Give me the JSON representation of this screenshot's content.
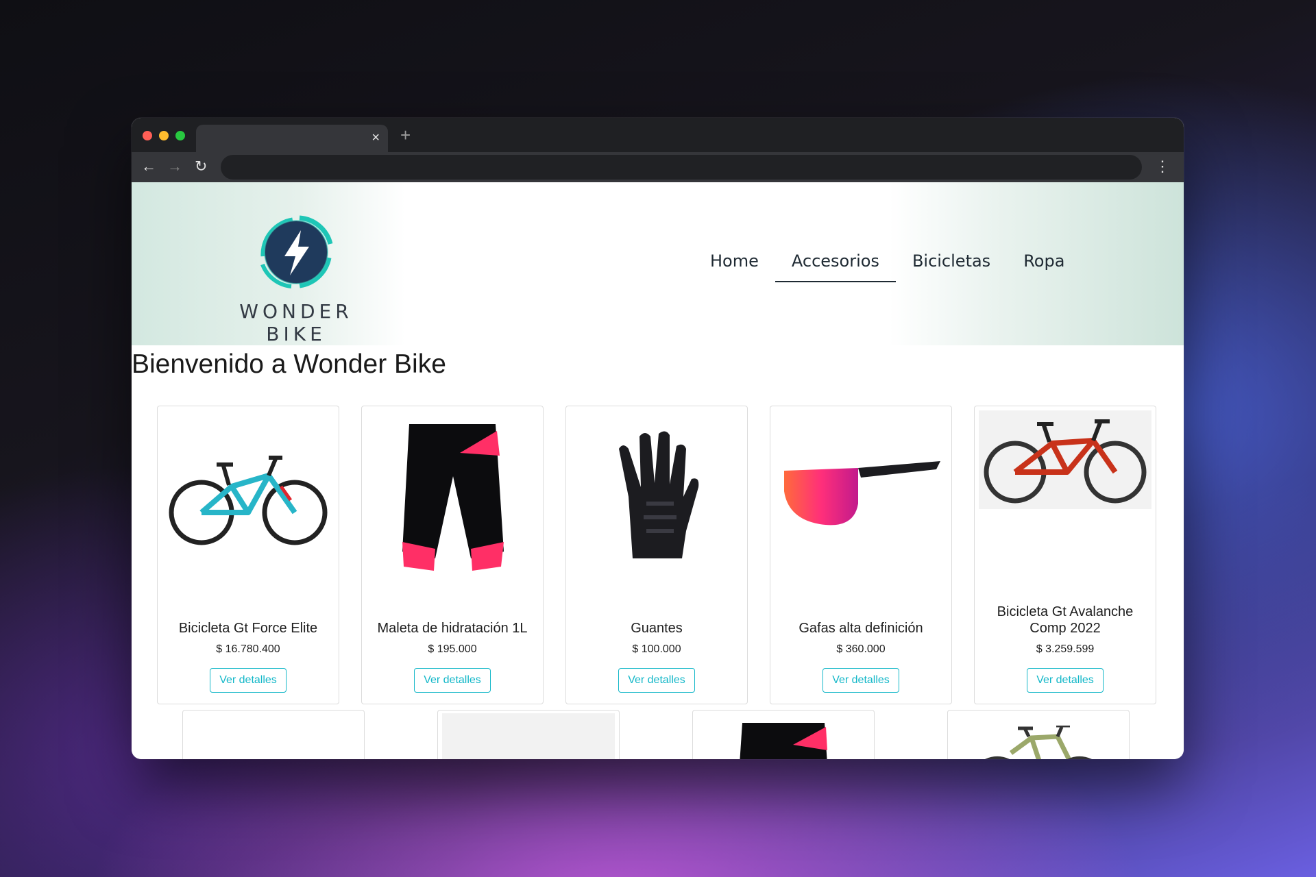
{
  "browser": {
    "tab_close": "×",
    "new_tab": "+",
    "back": "←",
    "forward": "→",
    "reload": "↻",
    "menu": "⋮",
    "traffic_lights": [
      "#ff5f57",
      "#febc2e",
      "#28c840"
    ]
  },
  "site": {
    "brand": "WONDER BIKE",
    "nav": [
      {
        "label": "Home",
        "active": false
      },
      {
        "label": "Accesorios",
        "active": true
      },
      {
        "label": "Bicicletas",
        "active": false
      },
      {
        "label": "Ropa",
        "active": false
      }
    ],
    "heading": "Bienvenido a Wonder Bike",
    "accent_color": "#12b7c8"
  },
  "products": [
    {
      "title": "Bicicleta Gt Force Elite",
      "price": "$ 16.780.400",
      "button": "Ver detalles",
      "image": "mountain-bike-teal"
    },
    {
      "title": "Maleta de hidratación 1L",
      "price": "$ 195.000",
      "button": "Ver detalles",
      "image": "cycling-shorts"
    },
    {
      "title": "Guantes",
      "price": "$ 100.000",
      "button": "Ver detalles",
      "image": "gloves"
    },
    {
      "title": "Gafas alta definición",
      "price": "$ 360.000",
      "button": "Ver detalles",
      "image": "sunglasses"
    },
    {
      "title": "Bicicleta Gt Avalanche Comp 2022",
      "price": "$ 3.259.599",
      "button": "Ver detalles",
      "image": "mountain-bike-red"
    }
  ],
  "products_row2": [
    {
      "image": "blank"
    },
    {
      "image": "cycling-jersey"
    },
    {
      "image": "cycling-shorts"
    },
    {
      "image": "mountain-bike-olive"
    }
  ]
}
